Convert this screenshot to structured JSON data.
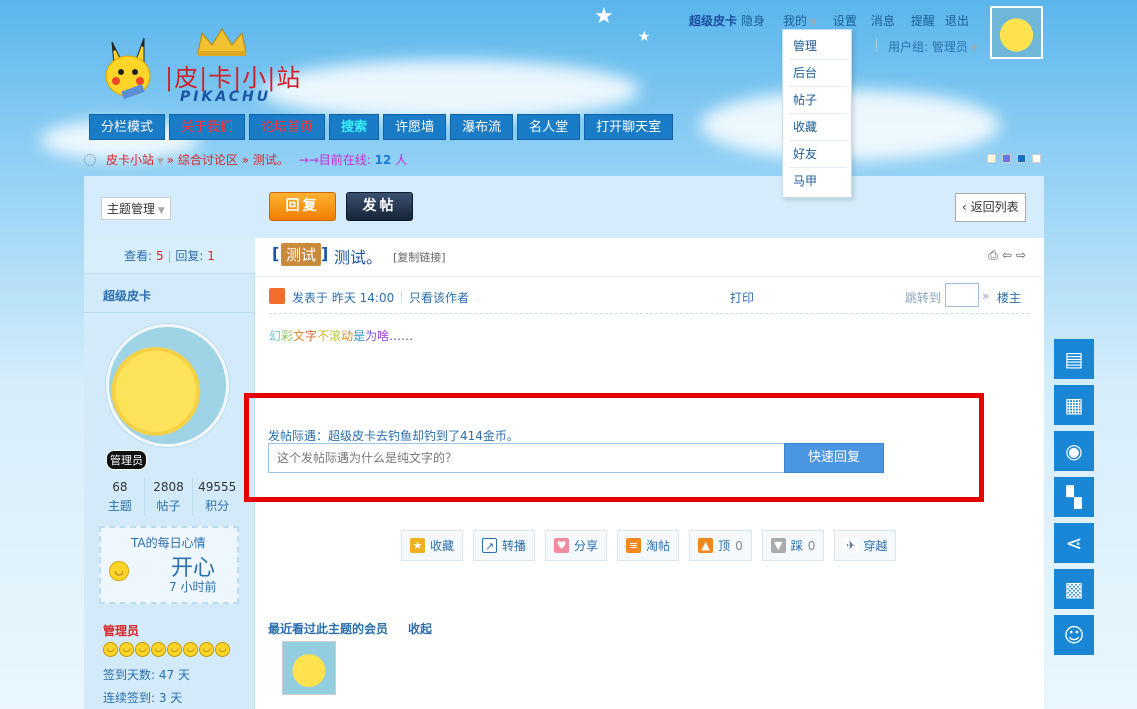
{
  "topbar": {
    "username": "超级皮卡",
    "invisible": "隐身",
    "mine": "我的",
    "settings": "设置",
    "messages": "消息",
    "reminders": "提醒",
    "logout": "退出",
    "usergroup": "用户组: 管理员"
  },
  "dropdown": [
    "管理",
    "后台",
    "帖子",
    "收藏",
    "好友",
    "马甲"
  ],
  "logo": {
    "title": "|皮|卡|小|站",
    "subtitle": "PIKACHU"
  },
  "nav": [
    "分栏模式",
    "关于我们",
    "论坛首页",
    "搜索",
    "许愿墙",
    "瀑布流",
    "名人堂",
    "打开聊天室"
  ],
  "breadcrumb": {
    "site": "皮卡小站",
    "forum": "» 综合讨论区",
    "thread": "» 测试。",
    "online_label": "→→目前在线:",
    "online_count": "12",
    "online_unit": "人"
  },
  "toolbar": {
    "topic_manage": "主题管理",
    "reply": "回复",
    "post": "发帖",
    "back": "返回列表"
  },
  "stats": {
    "views_label": "查看:",
    "views": "5",
    "replies_label": "回复:",
    "replies": "1"
  },
  "author": {
    "name": "超级皮卡",
    "badge": "管理员",
    "topics": "68",
    "topics_label": "主题",
    "posts": "2808",
    "posts_label": "帖子",
    "points": "49555",
    "points_label": "积分",
    "mood_title": "TA的每日心情",
    "mood": "开心",
    "mood_time": "7 小时前",
    "group": "管理员",
    "sign_days": "签到天数: 47 天",
    "sign_cont": "连续签到: 3 天"
  },
  "thread": {
    "tag": "测试",
    "title": "测试。",
    "copy_link": "[复制链接]",
    "posted": "发表于 昨天 14:00",
    "author_only": "只看该作者",
    "print": "打印",
    "jump": "跳转到",
    "floor": "楼主",
    "body": [
      "幻",
      "彩",
      "文",
      "字",
      "不",
      "滚",
      "动",
      "是",
      "为",
      "啥",
      "……"
    ]
  },
  "quick": {
    "fish": "发帖际遇：超级皮卡去钓鱼却钓到了414金币。",
    "placeholder": "这个发帖际遇为什么是纯文字的？",
    "button": "快速回复"
  },
  "actions": [
    {
      "label": "收藏",
      "count": ""
    },
    {
      "label": "转播",
      "count": ""
    },
    {
      "label": "分享",
      "count": ""
    },
    {
      "label": "淘帖",
      "count": ""
    },
    {
      "label": "顶",
      "count": "0"
    },
    {
      "label": "踩",
      "count": "0"
    },
    {
      "label": "穿越",
      "count": ""
    }
  ],
  "viewed": {
    "title": "最近看过此主题的会员",
    "collapse": "收起"
  },
  "colors": {
    "accent": "#1a87d6",
    "highlight": "#e60000"
  }
}
